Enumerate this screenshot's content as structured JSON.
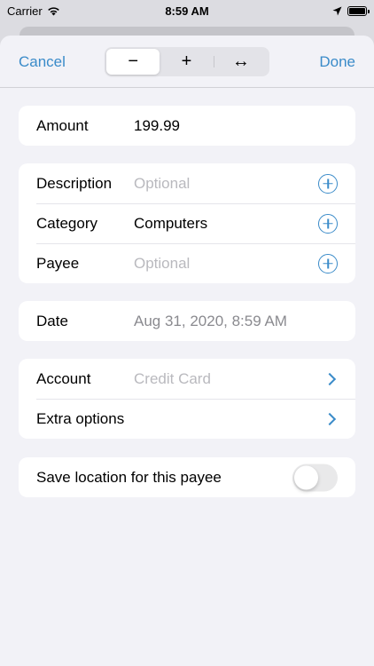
{
  "status_bar": {
    "carrier": "Carrier",
    "time": "8:59 AM",
    "icons": [
      "wifi-icon",
      "location-arrow-icon",
      "battery-icon"
    ]
  },
  "nav": {
    "cancel_label": "Cancel",
    "done_label": "Done",
    "segments": [
      {
        "label": "−",
        "selected": true
      },
      {
        "label": "+",
        "selected": false
      },
      {
        "label": "↔",
        "selected": false
      }
    ]
  },
  "amount": {
    "label": "Amount",
    "value": "199.99"
  },
  "details": {
    "description": {
      "label": "Description",
      "placeholder": "Optional"
    },
    "category": {
      "label": "Category",
      "value": "Computers"
    },
    "payee": {
      "label": "Payee",
      "placeholder": "Optional"
    }
  },
  "date": {
    "label": "Date",
    "value": "Aug 31, 2020, 8:59 AM"
  },
  "account_section": {
    "account": {
      "label": "Account",
      "value": "Credit Card"
    },
    "extra": {
      "label": "Extra options"
    }
  },
  "location": {
    "label": "Save location for this payee",
    "toggle_on": false
  },
  "colors": {
    "accent": "#3a8bc9",
    "background": "#f2f2f7",
    "placeholder": "#b9b9be"
  }
}
